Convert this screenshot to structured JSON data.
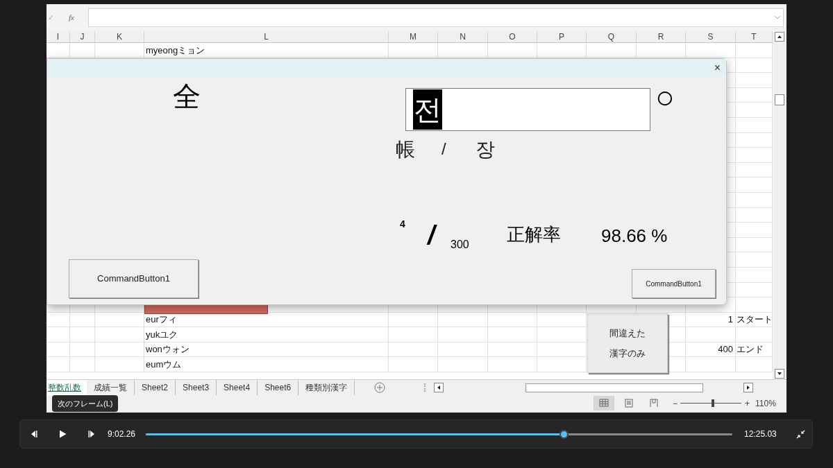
{
  "formula_bar": {
    "fx": "fx",
    "cancel": "✓"
  },
  "columns": [
    "I",
    "J",
    "K",
    "L",
    "M",
    "N",
    "O",
    "P",
    "Q",
    "R",
    "S",
    "T"
  ],
  "rows": [
    {
      "l": "myeongミョン"
    },
    {
      "l": "eurフィ",
      "s": "1",
      "t": "スタート"
    },
    {
      "l": "yukユク"
    },
    {
      "l": "wonウォン",
      "s": "400",
      "t": "エンド"
    },
    {
      "l": "eumウム"
    }
  ],
  "sheet_button": {
    "label_lines": [
      "間違えた",
      "漢字のみ"
    ]
  },
  "dialog": {
    "close": "×",
    "kanji": "全",
    "answer": {
      "value": "전",
      "value_selected": true
    },
    "mark": "○",
    "reading_left": "帳",
    "reading_sep": "/",
    "reading_right": "장",
    "count": "4",
    "count_sep": "/",
    "total": "300",
    "rate_label": "正解率",
    "rate": "98.66 %",
    "buttons": [
      "CommandButton1",
      "CommandButton1"
    ]
  },
  "sheet_tabs": [
    {
      "label": "整数乱数",
      "selected": true
    },
    {
      "label": "成績一覧",
      "selected": false
    },
    {
      "label": "Sheet2",
      "selected": false
    },
    {
      "label": "Sheet3",
      "selected": false
    },
    {
      "label": "Sheet4",
      "selected": false
    },
    {
      "label": "Sheet6",
      "selected": false
    },
    {
      "label": "種類別漢字",
      "selected": false
    }
  ],
  "status_bar": {
    "views": [
      {
        "kind": "normal",
        "selected": true
      },
      {
        "kind": "page_layout",
        "selected": false
      },
      {
        "kind": "page_break",
        "selected": false
      }
    ],
    "zoom_minus": "−",
    "zoom_plus": "+",
    "zoom": {
      "level": 0.53
    },
    "zoom_text": "110%"
  },
  "tooltip": "次のフレーム(L)",
  "player": {
    "elapsed": "9:02.26",
    "total": "12:25.03",
    "level": 0.712
  }
}
